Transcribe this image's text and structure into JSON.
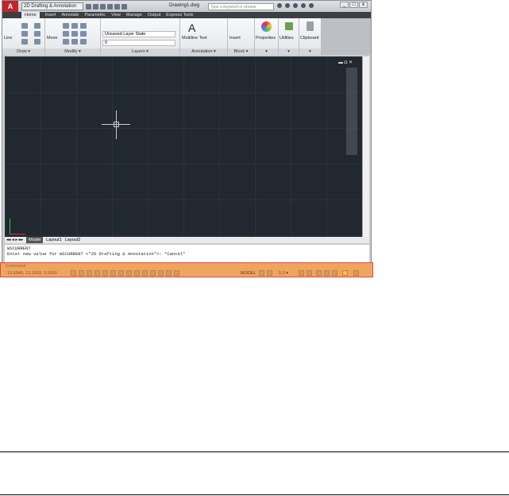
{
  "title_bar": {
    "logo": "A",
    "workspace": "2D Drafting & Annotation",
    "document": "Drawing1.dwg",
    "search_placeholder": "Type a keyword or phrase",
    "window_controls": [
      "_",
      "□",
      "x"
    ]
  },
  "tabs": [
    "Home",
    "Insert",
    "Annotate",
    "Parametric",
    "View",
    "Manage",
    "Output",
    "Express Tools"
  ],
  "ribbon": {
    "draw": {
      "label": "Draw ▾",
      "line": "Line"
    },
    "modify": {
      "label": "Modify ▾",
      "move": "Move"
    },
    "layers": {
      "label": "Layers ▾",
      "layer_state": "Unsaved Layer State",
      "layer": "0"
    },
    "annotation": {
      "label": "Annotation ▾",
      "text": "Multiline Text"
    },
    "block": {
      "label": "Block ▾",
      "insert": "Insert"
    },
    "properties": {
      "label": "Properties",
      "arrow": "▾"
    },
    "utilities": {
      "label": "Utilities",
      "arrow": "▾"
    },
    "clipboard": {
      "label": "Clipboard",
      "arrow": "▾"
    }
  },
  "layout_tabs": [
    "Model",
    "Layout1",
    "Layout2"
  ],
  "command": {
    "lines": [
      "WSCURRENT",
      "Enter new value for WSCURRENT <\"2D Drafting & Annotation\">: *Cancel*"
    ],
    "prompt": "Command:"
  },
  "status": {
    "coords": "13.5548, 13.3363, 0.0000",
    "model": "MODEL",
    "scale": "1:1 ▾"
  }
}
